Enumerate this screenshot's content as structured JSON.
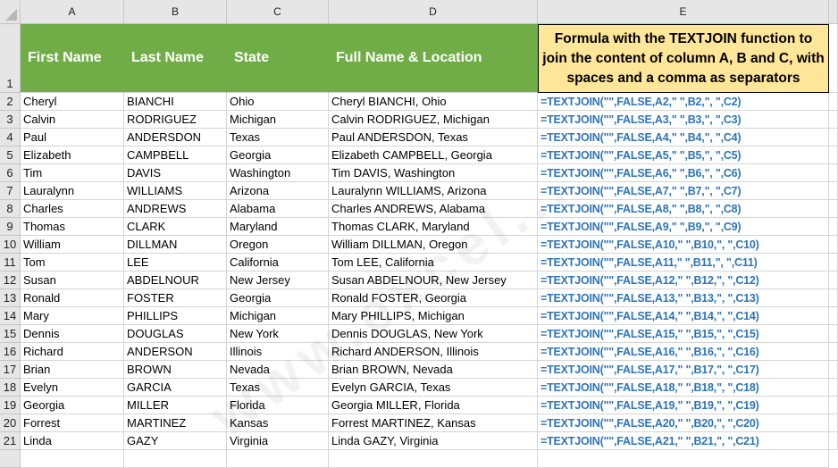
{
  "columns": [
    "A",
    "B",
    "C",
    "D",
    "E"
  ],
  "header": {
    "row_number": "1",
    "first_name": "First Name",
    "last_name": "Last Name",
    "state": "State",
    "full_name_location": "Full Name & Location",
    "formula_description": "Formula with the TEXTJOIN function to join the content of column A, B and C, with spaces and a comma as separators"
  },
  "rows": [
    {
      "n": "2",
      "first": "Cheryl",
      "last": "BIANCHI",
      "state": "Ohio",
      "full": "Cheryl BIANCHI, Ohio",
      "formula": "=TEXTJOIN(\"\",FALSE,A2,\" \",B2,\", \",C2)"
    },
    {
      "n": "3",
      "first": "Calvin",
      "last": "RODRIGUEZ",
      "state": "Michigan",
      "full": "Calvin RODRIGUEZ, Michigan",
      "formula": "=TEXTJOIN(\"\",FALSE,A3,\" \",B3,\", \",C3)"
    },
    {
      "n": "4",
      "first": "Paul",
      "last": "ANDERSDON",
      "state": "Texas",
      "full": "Paul ANDERSDON, Texas",
      "formula": "=TEXTJOIN(\"\",FALSE,A4,\" \",B4,\", \",C4)"
    },
    {
      "n": "5",
      "first": "Elizabeth",
      "last": "CAMPBELL",
      "state": "Georgia",
      "full": "Elizabeth CAMPBELL, Georgia",
      "formula": "=TEXTJOIN(\"\",FALSE,A5,\" \",B5,\", \",C5)"
    },
    {
      "n": "6",
      "first": "Tim",
      "last": "DAVIS",
      "state": "Washington",
      "full": "Tim DAVIS, Washington",
      "formula": "=TEXTJOIN(\"\",FALSE,A6,\" \",B6,\", \",C6)"
    },
    {
      "n": "7",
      "first": "Lauralynn",
      "last": "WILLIAMS",
      "state": "Arizona",
      "full": "Lauralynn WILLIAMS, Arizona",
      "formula": "=TEXTJOIN(\"\",FALSE,A7,\" \",B7,\", \",C7)"
    },
    {
      "n": "8",
      "first": "Charles",
      "last": "ANDREWS",
      "state": "Alabama",
      "full": "Charles ANDREWS, Alabama",
      "formula": "=TEXTJOIN(\"\",FALSE,A8,\" \",B8,\", \",C8)"
    },
    {
      "n": "9",
      "first": "Thomas",
      "last": "CLARK",
      "state": "Maryland",
      "full": "Thomas CLARK, Maryland",
      "formula": "=TEXTJOIN(\"\",FALSE,A9,\" \",B9,\", \",C9)"
    },
    {
      "n": "10",
      "first": "William",
      "last": "DILLMAN",
      "state": "Oregon",
      "full": "William DILLMAN, Oregon",
      "formula": "=TEXTJOIN(\"\",FALSE,A10,\" \",B10,\", \",C10)"
    },
    {
      "n": "11",
      "first": "Tom",
      "last": "LEE",
      "state": "California",
      "full": "Tom LEE, California",
      "formula": "=TEXTJOIN(\"\",FALSE,A11,\" \",B11,\", \",C11)"
    },
    {
      "n": "12",
      "first": "Susan",
      "last": "ABDELNOUR",
      "state": "New Jersey",
      "full": "Susan ABDELNOUR, New Jersey",
      "formula": "=TEXTJOIN(\"\",FALSE,A12,\" \",B12,\", \",C12)"
    },
    {
      "n": "13",
      "first": "Ronald",
      "last": "FOSTER",
      "state": "Georgia",
      "full": "Ronald FOSTER, Georgia",
      "formula": "=TEXTJOIN(\"\",FALSE,A13,\" \",B13,\", \",C13)"
    },
    {
      "n": "14",
      "first": "Mary",
      "last": "PHILLIPS",
      "state": "Michigan",
      "full": "Mary PHILLIPS, Michigan",
      "formula": "=TEXTJOIN(\"\",FALSE,A14,\" \",B14,\", \",C14)"
    },
    {
      "n": "15",
      "first": "Dennis",
      "last": "DOUGLAS",
      "state": "New York",
      "full": "Dennis DOUGLAS, New York",
      "formula": "=TEXTJOIN(\"\",FALSE,A15,\" \",B15,\", \",C15)"
    },
    {
      "n": "16",
      "first": "Richard",
      "last": "ANDERSON",
      "state": "Illinois",
      "full": "Richard ANDERSON, Illinois",
      "formula": "=TEXTJOIN(\"\",FALSE,A16,\" \",B16,\", \",C16)"
    },
    {
      "n": "17",
      "first": "Brian",
      "last": "BROWN",
      "state": "Nevada",
      "full": "Brian BROWN, Nevada",
      "formula": "=TEXTJOIN(\"\",FALSE,A17,\" \",B17,\", \",C17)"
    },
    {
      "n": "18",
      "first": "Evelyn",
      "last": "GARCIA",
      "state": "Texas",
      "full": "Evelyn GARCIA, Texas",
      "formula": "=TEXTJOIN(\"\",FALSE,A18,\" \",B18,\", \",C18)"
    },
    {
      "n": "19",
      "first": "Georgia",
      "last": "MILLER",
      "state": "Florida",
      "full": "Georgia MILLER, Florida",
      "formula": "=TEXTJOIN(\"\",FALSE,A19,\" \",B19,\", \",C19)"
    },
    {
      "n": "20",
      "first": "Forrest",
      "last": "MARTINEZ",
      "state": "Kansas",
      "full": "Forrest MARTINEZ, Kansas",
      "formula": "=TEXTJOIN(\"\",FALSE,A20,\" \",B20,\", \",C20)"
    },
    {
      "n": "21",
      "first": "Linda",
      "last": "GAZY",
      "state": "Virginia",
      "full": "Linda GAZY, Virginia",
      "formula": "=TEXTJOIN(\"\",FALSE,A21,\" \",B21,\", \",C21)"
    }
  ],
  "watermark": "www.excel..."
}
